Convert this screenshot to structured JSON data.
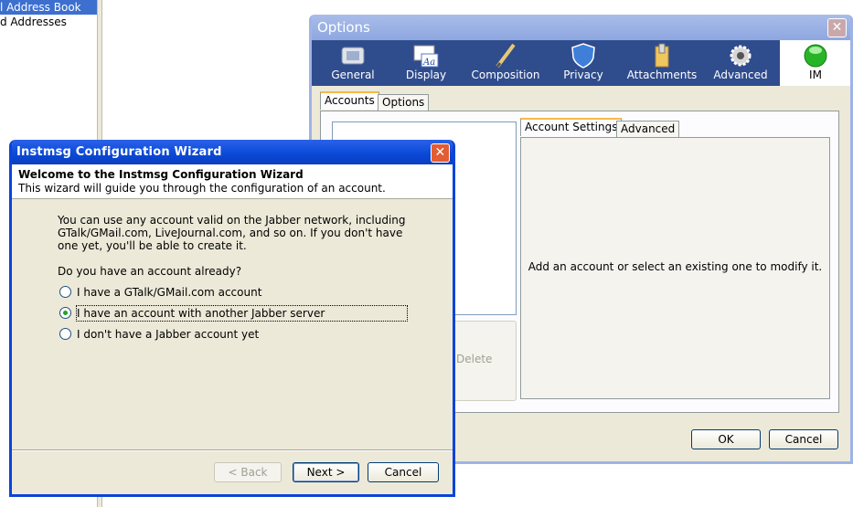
{
  "background": {
    "rows": [
      "l Address Book",
      "d Addresses"
    ]
  },
  "options": {
    "title": "Options",
    "toolbar": [
      {
        "label": "General",
        "icon": "general-icon"
      },
      {
        "label": "Display",
        "icon": "display-icon"
      },
      {
        "label": "Composition",
        "icon": "pen-icon"
      },
      {
        "label": "Privacy",
        "icon": "shield-icon"
      },
      {
        "label": "Attachments",
        "icon": "paperclip-icon"
      },
      {
        "label": "Advanced",
        "icon": "gear-icon"
      },
      {
        "label": "IM",
        "icon": "green-orb-icon"
      }
    ],
    "tabs": [
      "Accounts",
      "Options"
    ],
    "inner_tabs": [
      "Account Settings",
      "Advanced"
    ],
    "hint": "Add an account or select an existing one to modify it.",
    "delete_label": "Delete",
    "ok_label": "OK",
    "cancel_label": "Cancel"
  },
  "wizard": {
    "title": "Instmsg Configuration Wizard",
    "heading": "Welcome to the Instmsg Configuration Wizard",
    "subheading": "This wizard will guide you through the configuration of an account.",
    "intro": "You can use any account valid on the Jabber network, including GTalk/GMail.com, LiveJournal.com, and so on. If you don't have one yet, you'll be able to create it.",
    "question": "Do you have an account already?",
    "options": [
      {
        "label": "I have a GTalk/GMail.com account",
        "selected": false
      },
      {
        "label": "I have an account with another Jabber server",
        "selected": true
      },
      {
        "label": "I don't have a Jabber account yet",
        "selected": false
      }
    ],
    "back_label": "< Back",
    "next_label": "Next >",
    "cancel_label": "Cancel"
  }
}
